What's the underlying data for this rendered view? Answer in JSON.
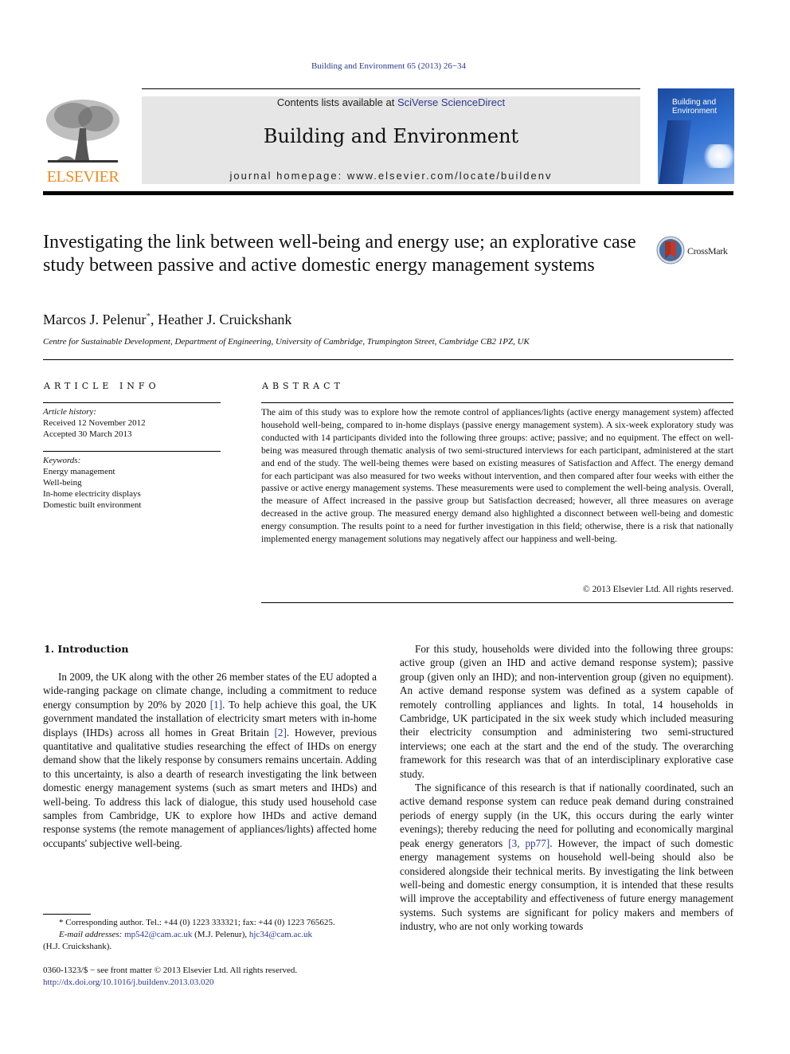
{
  "header": {
    "citation": "Building and Environment 65 (2013) 26−34",
    "contents_prefix": "Contents lists available at ",
    "contents_link": "SciVerse ScienceDirect",
    "journal_name": "Building and Environment",
    "homepage": "journal homepage: www.elsevier.com/locate/buildenv",
    "publisher_logo": "ELSEVIER",
    "cover_title_line1": "Building and",
    "cover_title_line2": "Environment",
    "colors": {
      "link": "#2b3a8f",
      "elsevier_orange": "#f08a1e",
      "masthead_bg": "#e6e6e6"
    }
  },
  "article": {
    "title": "Investigating the link between well-being and energy use; an explorative case study between passive and active domestic energy management systems",
    "crossmark_label": "CrossMark",
    "authors": [
      {
        "name": "Marcos J. Pelenur",
        "mark": "*"
      },
      {
        "name": "Heather J. Cruickshank",
        "mark": ""
      }
    ],
    "author_separator": ", ",
    "affiliation": "Centre for Sustainable Development, Department of Engineering, University of Cambridge, Trumpington Street, Cambridge CB2 1PZ, UK"
  },
  "article_info": {
    "heading": "ARTICLE INFO",
    "history_label": "Article history:",
    "received": "Received 12 November 2012",
    "accepted": "Accepted 30 March 2013",
    "keywords_label": "Keywords:",
    "keywords": [
      "Energy management",
      "Well-being",
      "In-home electricity displays",
      "Domestic built environment"
    ]
  },
  "abstract": {
    "heading": "ABSTRACT",
    "text": "The aim of this study was to explore how the remote control of appliances/lights (active energy management system) affected household well-being, compared to in-home displays (passive energy management system). A six-week exploratory study was conducted with 14 participants divided into the following three groups: active; passive; and no equipment. The effect on well-being was measured through thematic analysis of two semi-structured interviews for each participant, administered at the start and end of the study. The well-being themes were based on existing measures of Satisfaction and Affect. The energy demand for each participant was also measured for two weeks without intervention, and then compared after four weeks with either the passive or active energy management systems. These measurements were used to complement the well-being analysis. Overall, the measure of Affect increased in the passive group but Satisfaction decreased; however, all three measures on average decreased in the active group. The measured energy demand also highlighted a disconnect between well-being and domestic energy consumption. The results point to a need for further investigation in this field; otherwise, there is a risk that nationally implemented energy management solutions may negatively affect our happiness and well-being.",
    "copyright": "© 2013 Elsevier Ltd. All rights reserved."
  },
  "body": {
    "section_heading": "1.  Introduction",
    "left_p1_a": "In 2009, the UK along with the other 26 member states of the EU adopted a wide-ranging package on climate change, including a commitment to reduce energy consumption by 20% by 2020 ",
    "ref1": "[1]",
    "left_p1_b": ". To help achieve this goal, the UK government mandated the installation of electricity smart meters with in-home displays (IHDs) across all homes in Great Britain ",
    "ref2": "[2]",
    "left_p1_c": ". However, previous quantitative and qualitative studies researching the effect of IHDs on energy demand show that the likely response by consumers remains uncertain. Adding to this uncertainty, is also a dearth of research investigating the link between domestic energy management systems (such as smart meters and IHDs) and well-being. To address this lack of dialogue, this study used household case samples from Cambridge, UK to explore how IHDs and active demand response systems (the remote management of appliances/lights) affected home occupants' subjective well-being.",
    "right_p1": "For this study, households were divided into the following three groups: active group (given an IHD and active demand response system); passive group (given only an IHD); and non-intervention group (given no equipment). An active demand response system was defined as a system capable of remotely controlling appliances and lights. In total, 14 households in Cambridge, UK participated in the six week study which included measuring their electricity consumption and administering two semi-structured interviews; one each at the start and the end of the study. The overarching framework for this research was that of an interdisciplinary explorative case study.",
    "right_p2_a": "The significance of this research is that if nationally coordinated, such an active demand response system can reduce peak demand during constrained periods of energy supply (in the UK, this occurs during the early winter evenings); thereby reducing the need for polluting and economically marginal peak energy generators ",
    "ref3": "[3, pp77]",
    "right_p2_b": ". However, the impact of such domestic energy management systems on household well-being should also be considered alongside their technical merits. By investigating the link between well-being and domestic energy consumption, it is intended that these results will improve the acceptability and effectiveness of future energy management systems. Such systems are significant for policy makers and members of industry, who are not only working towards"
  },
  "footnote": {
    "corresponding": "* Corresponding author. Tel.: +44 (0) 1223 333321; fax: +44 (0) 1223 765625.",
    "email_label": "E-mail addresses:",
    "email1": "mp542@cam.ac.uk",
    "email1_owner": " (M.J. Pelenur), ",
    "email2": "hjc34@cam.ac.uk",
    "email2_owner": "(H.J. Cruickshank).",
    "front_matter": "0360-1323/$ − see front matter © 2013 Elsevier Ltd. All rights reserved.",
    "doi": "http://dx.doi.org/10.1016/j.buildenv.2013.03.020"
  }
}
